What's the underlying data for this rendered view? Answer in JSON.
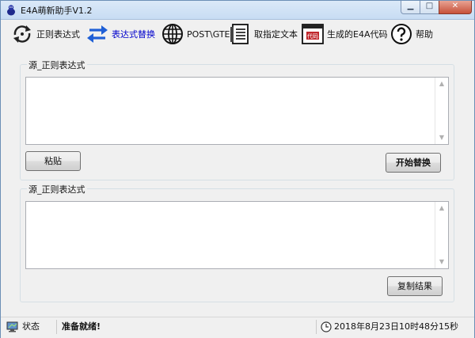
{
  "window": {
    "title": "E4A萌新助手V1.2",
    "min_glyph": "▁",
    "max_glyph": "□",
    "close_glyph": "✕"
  },
  "toolbar": {
    "items": [
      {
        "label": "正则表达式",
        "icon": "regex-refresh-icon"
      },
      {
        "label": "表达式替换",
        "icon": "replace-arrows-icon",
        "active": true
      },
      {
        "label": "POST\\GTE",
        "icon": "globe-icon"
      },
      {
        "label": "取指定文本",
        "icon": "document-icon"
      },
      {
        "label": "生成的E4A代码",
        "icon": "code-window-icon",
        "badge": "代码"
      },
      {
        "label": "帮助",
        "icon": "help-icon"
      }
    ]
  },
  "source_group": {
    "title": "源_正则表达式",
    "value": ""
  },
  "result_group": {
    "title": "源_正则表达式",
    "value": ""
  },
  "buttons": {
    "paste": "粘贴",
    "start_replace": "开始替换",
    "copy_result": "复制结果"
  },
  "statusbar": {
    "state_label": "状态",
    "message": "准备就绪!",
    "datetime": "2018年8月23日10时48分15秒"
  },
  "colors": {
    "accent": "#0000cc",
    "replace_blue": "#1f5fd6",
    "code_red": "#c0282d"
  }
}
